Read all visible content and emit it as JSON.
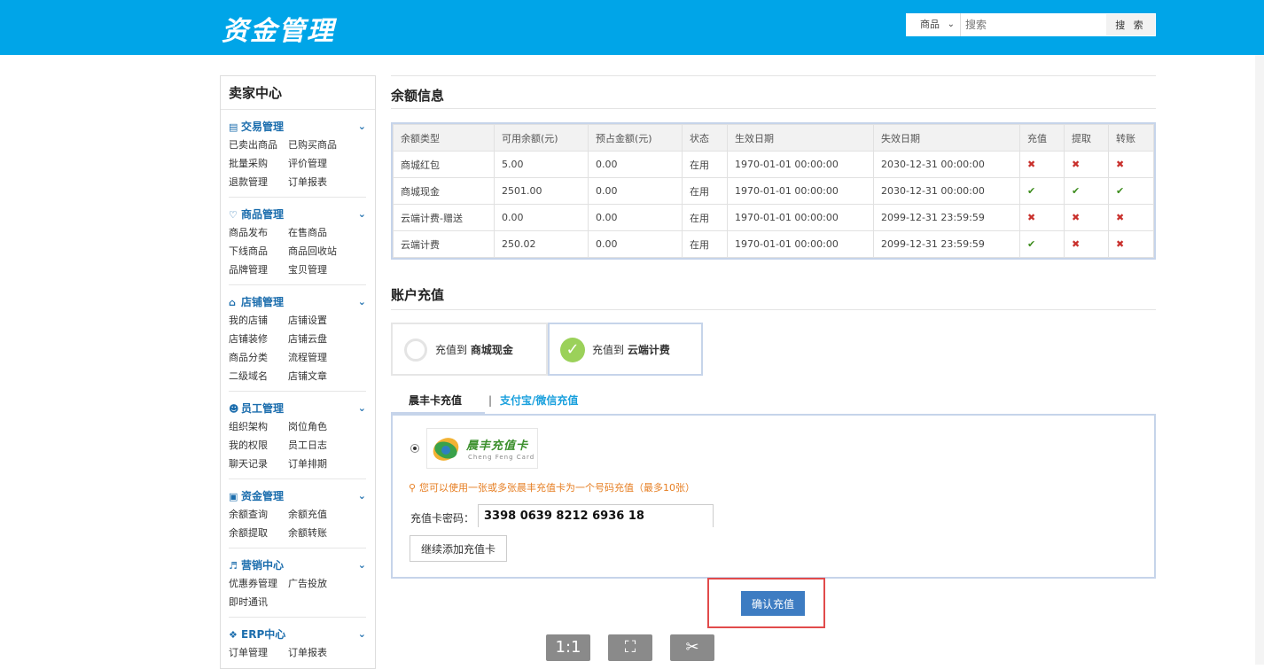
{
  "header": {
    "logo": "资金管理",
    "search": {
      "select_value": "商品",
      "placeholder": "搜索",
      "button": "搜 索"
    }
  },
  "sidebar": {
    "title": "卖家中心",
    "groups": [
      {
        "title": "交易管理",
        "icon": "list-icon",
        "items": [
          "已卖出商品",
          "已购买商品",
          "批量采购",
          "评价管理",
          "退款管理",
          "订单报表"
        ]
      },
      {
        "title": "商品管理",
        "icon": "heart-icon",
        "items": [
          "商品发布",
          "在售商品",
          "下线商品",
          "商品回收站",
          "品牌管理",
          "宝贝管理"
        ]
      },
      {
        "title": "店铺管理",
        "icon": "home-icon",
        "items": [
          "我的店铺",
          "店铺设置",
          "店铺装修",
          "店铺云盘",
          "商品分类",
          "流程管理",
          "二级域名",
          "店铺文章"
        ]
      },
      {
        "title": "员工管理",
        "icon": "users-icon",
        "items": [
          "组织架构",
          "岗位角色",
          "我的权限",
          "员工日志",
          "聊天记录",
          "订单排期"
        ]
      },
      {
        "title": "资金管理",
        "icon": "money-icon",
        "items": [
          "余额查询",
          "余额充值",
          "余额提取",
          "余额转账"
        ]
      },
      {
        "title": "营销中心",
        "icon": "megaphone-icon",
        "items": [
          "优惠券管理",
          "广告投放",
          "即时通讯"
        ]
      },
      {
        "title": "ERP中心",
        "icon": "erp-icon",
        "items": [
          "订单管理",
          "订单报表"
        ]
      }
    ]
  },
  "balance": {
    "title": "余额信息",
    "columns": [
      "余额类型",
      "可用余额(元)",
      "预占金额(元)",
      "状态",
      "生效日期",
      "失效日期",
      "充值",
      "提取",
      "转账"
    ],
    "rows": [
      {
        "type": "商城红包",
        "available": "5.00",
        "reserved": "0.00",
        "status": "在用",
        "start": "1970-01-01 00:00:00",
        "end": "2030-12-31 00:00:00",
        "recharge": false,
        "withdraw": false,
        "transfer": false
      },
      {
        "type": "商城现金",
        "available": "2501.00",
        "reserved": "0.00",
        "status": "在用",
        "start": "1970-01-01 00:00:00",
        "end": "2030-12-31 00:00:00",
        "recharge": true,
        "withdraw": true,
        "transfer": true
      },
      {
        "type": "云端计费-赠送",
        "available": "0.00",
        "reserved": "0.00",
        "status": "在用",
        "start": "1970-01-01 00:00:00",
        "end": "2099-12-31 23:59:59",
        "recharge": false,
        "withdraw": false,
        "transfer": false
      },
      {
        "type": "云端计费",
        "available": "250.02",
        "reserved": "0.00",
        "status": "在用",
        "start": "1970-01-01 00:00:00",
        "end": "2099-12-31 23:59:59",
        "recharge": true,
        "withdraw": false,
        "transfer": false
      }
    ]
  },
  "recharge": {
    "title": "账户充值",
    "options": [
      {
        "prefix": "充值到",
        "target": "商城现金",
        "selected": false
      },
      {
        "prefix": "充值到",
        "target": "云端计费",
        "selected": true
      }
    ],
    "tabs": {
      "active": "晨丰卡充值",
      "separator": "|",
      "other": "支付宝/微信充值"
    },
    "card": {
      "brand_name": "晨丰充值卡",
      "brand_sub": "Cheng Feng Card",
      "tip": "您可以使用一张或多张晨丰充值卡为一个号码充值（最多10张）",
      "password_label": "充值卡密码：",
      "password_value": "3398 0639 8212 6936 18",
      "add_button": "继续添加充值卡"
    },
    "confirm_button": "确认充值"
  },
  "viewer": {
    "actual_size": "1:1",
    "fit_label": "⛶",
    "crop_label": "✂"
  },
  "colors": {
    "header": "#00a5e8",
    "accent": "#1b6dad",
    "link": "#1aa0dd",
    "confirm": "#3d7cc2",
    "highlight": "#e14b4b",
    "tip": "#e67e22"
  }
}
